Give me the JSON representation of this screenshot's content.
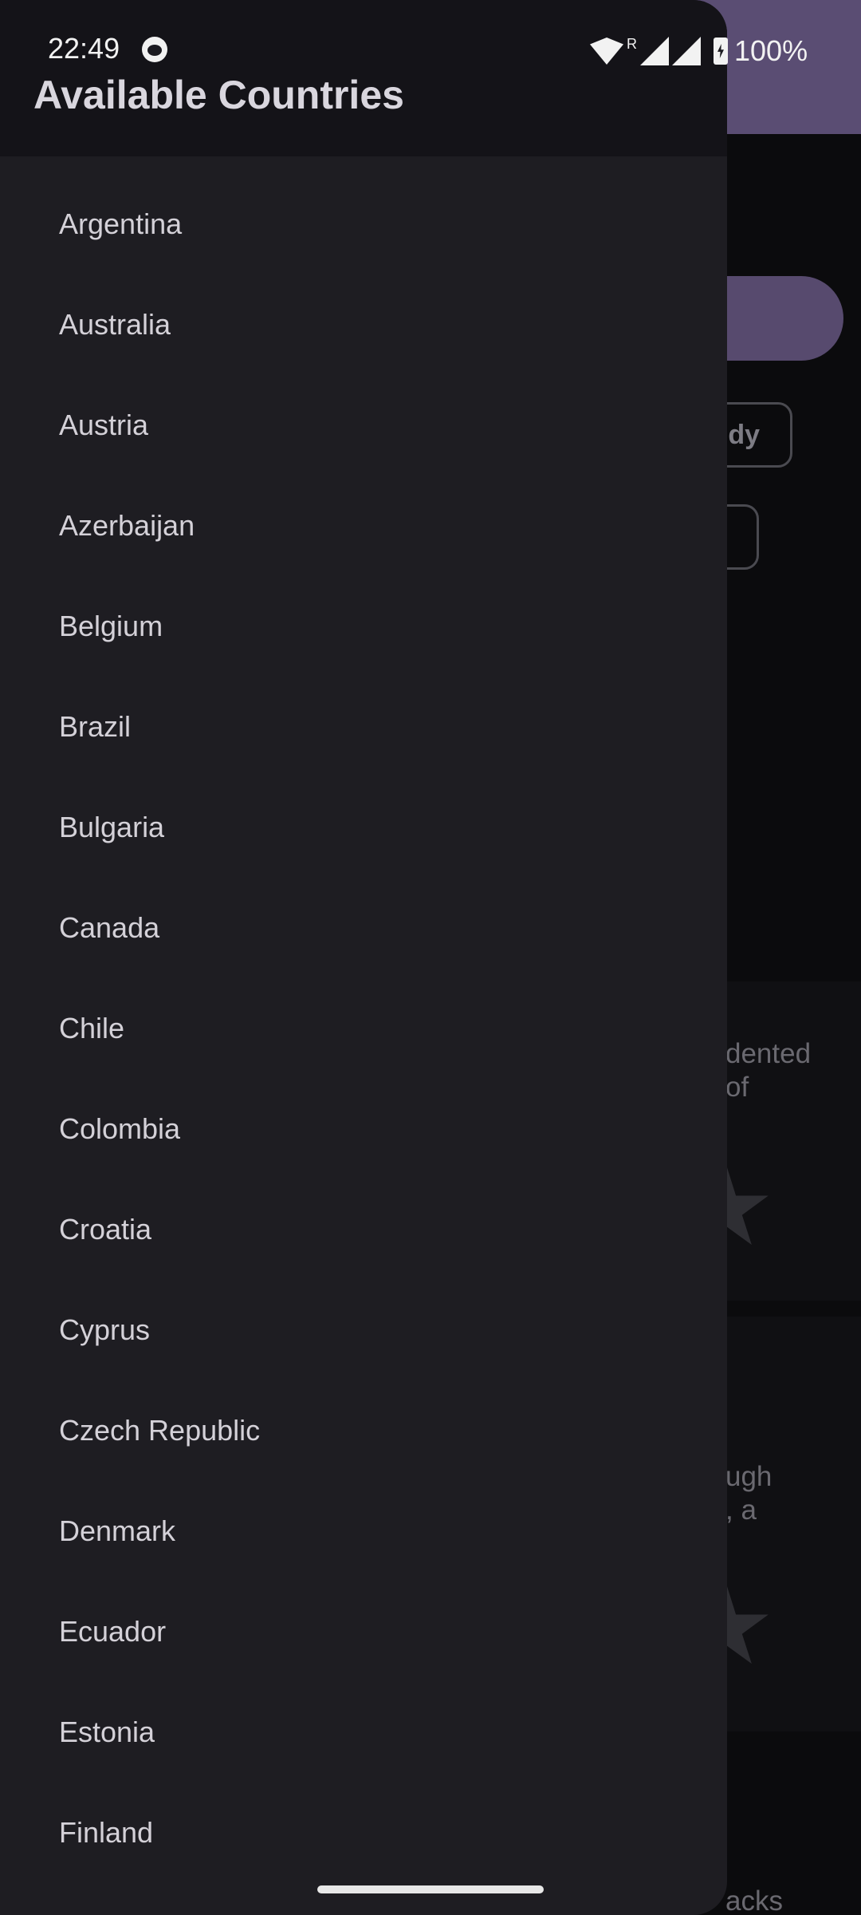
{
  "status_bar": {
    "time": "22:49",
    "battery_percent": "100%",
    "network_badge": "R",
    "icons": [
      "face-icon",
      "wifi-icon",
      "signal-icon",
      "battery-icon"
    ]
  },
  "drawer": {
    "title": "Available Countries",
    "countries": [
      "Argentina",
      "Australia",
      "Austria",
      "Azerbaijan",
      "Belgium",
      "Brazil",
      "Bulgaria",
      "Canada",
      "Chile",
      "Colombia",
      "Croatia",
      "Cyprus",
      "Czech Republic",
      "Denmark",
      "Ecuador",
      "Estonia",
      "Finland"
    ]
  },
  "background": {
    "chip_one_label": "dy",
    "card_one_text": "dented\nof",
    "card_two_text": "ugh\n, a",
    "card_three_text": "acks"
  },
  "colors": {
    "drawer_bg": "#1e1d22",
    "header_bg": "#141318",
    "accent_purple": "#5a4d73"
  }
}
